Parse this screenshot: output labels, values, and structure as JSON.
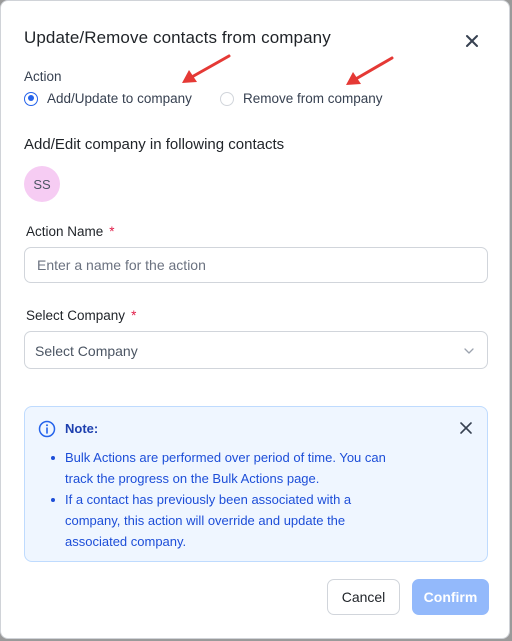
{
  "dialog": {
    "title": "Update/Remove contacts from company"
  },
  "action": {
    "label": "Action",
    "options": [
      {
        "label": "Add/Update to company",
        "selected": true
      },
      {
        "label": "Remove from company",
        "selected": false
      }
    ]
  },
  "contacts": {
    "heading": "Add/Edit company in following contacts",
    "avatar_initials": "SS"
  },
  "action_name": {
    "label": "Action Name",
    "required_mark": "*",
    "value": "",
    "placeholder": "Enter a name for the action"
  },
  "company": {
    "label": "Select Company",
    "required_mark": "*",
    "selected": "Select Company"
  },
  "note": {
    "title": "Note:",
    "items": [
      "Bulk Actions are performed over period of time. You can track the progress on the Bulk Actions page.",
      "If a contact has previously been associated with a company, this action will override and update the associated company."
    ]
  },
  "footer": {
    "cancel_label": "Cancel",
    "confirm_label": "Confirm"
  },
  "colors": {
    "accent": "#2563eb",
    "confirm_disabled": "#93b9fb",
    "avatar_bg": "#f6ccf3",
    "note_bg": "#eff6ff",
    "required": "#e11d48",
    "annotation_arrow": "#e53935"
  },
  "icons": {
    "close": "close-icon",
    "info": "info-icon",
    "chevron": "chevron-down-icon"
  }
}
